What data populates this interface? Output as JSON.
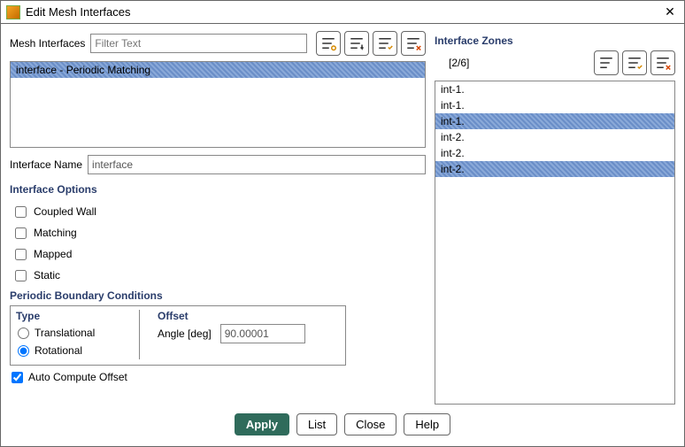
{
  "title": "Edit Mesh Interfaces",
  "left": {
    "mesh_interfaces_label": "Mesh Interfaces",
    "filter_placeholder": "Filter Text",
    "list": [
      "interface - Periodic Matching"
    ],
    "selected": [
      0
    ],
    "interface_name_label": "Interface Name",
    "interface_name_value": "interface"
  },
  "options": {
    "header": "Interface Options",
    "items": [
      {
        "label": "Coupled Wall",
        "checked": false
      },
      {
        "label": "Matching",
        "checked": false
      },
      {
        "label": "Mapped",
        "checked": false
      },
      {
        "label": "Static",
        "checked": false
      }
    ]
  },
  "pbc": {
    "header": "Periodic Boundary Conditions",
    "type_label": "Type",
    "offset_label": "Offset",
    "translational": "Translational",
    "rotational": "Rotational",
    "selected_type": "rotational",
    "angle_label": "Angle [deg]",
    "angle_value": "90.00001",
    "auto_label": "Auto Compute Offset",
    "auto_checked": true
  },
  "zones": {
    "header": "Interface Zones",
    "count": "[2/6]",
    "items": [
      "int-1.",
      "int-1.",
      "int-1.",
      "int-2.",
      "int-2.",
      "int-2."
    ],
    "selected": [
      2,
      5
    ]
  },
  "buttons": {
    "apply": "Apply",
    "list": "List",
    "close": "Close",
    "help": "Help"
  }
}
